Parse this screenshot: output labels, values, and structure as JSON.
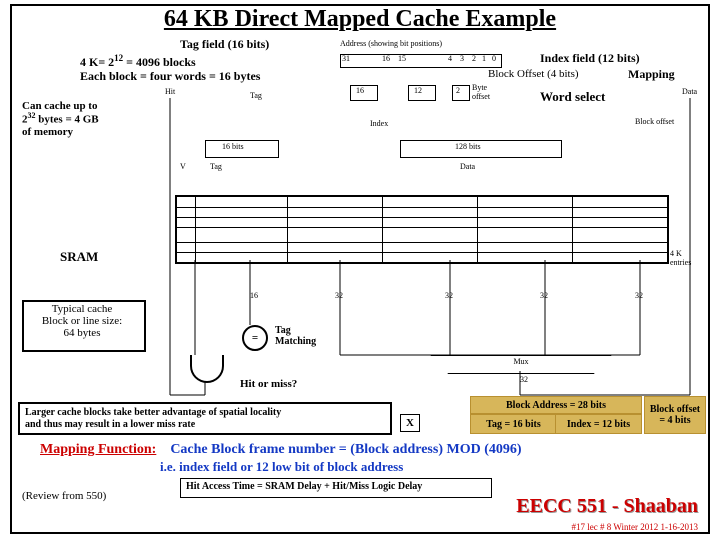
{
  "title": "64 KB Direct Mapped Cache Example",
  "header": {
    "tag_field": "Tag field (16 bits)",
    "addr_caption": "Address (showing bit positions)",
    "blocks_line_a": "4 K= 2",
    "blocks_line_sup": "12",
    "blocks_line_b": "= 4096 blocks",
    "each_block": "Each block = four words = 16 bytes",
    "index_field": "Index field (12 bits)",
    "block_offset": "Block Offset (4 bits)",
    "mapping": "Mapping",
    "word_select": "Word select",
    "hit": "Hit",
    "tag": "Tag",
    "index": "Index",
    "data_r": "Data",
    "block_offset_lbl": "Block offset",
    "bits16": "16 bits",
    "bits128": "128 bits",
    "vlabel": "V",
    "tag2": "Tag",
    "data2": "Data",
    "can_cache_a": "Can cache up to",
    "can_cache_b": "2",
    "can_cache_sup": "32",
    "can_cache_c": " bytes = 4 GB",
    "can_cache_d": "of memory",
    "byte_offset": "Byte\noffset"
  },
  "bit_positions": {
    "a": "31",
    "b": "16",
    "c": "15",
    "d": "4",
    "e": "3",
    "f": "2",
    "g": "1",
    "h": "0",
    "p16": "16",
    "p12": "12",
    "p2": "2"
  },
  "sram": {
    "label": "SRAM",
    "entries": "4 K\nentries",
    "typical": "Typical cache\nBlock or line size:\n64 bytes"
  },
  "lower": {
    "w16": "16",
    "w32": "32",
    "eq": "=",
    "tag_match": "Tag\nMatching",
    "hitmiss": "Hit or miss?",
    "mux": "Mux",
    "w32b": "32"
  },
  "bottom_left": {
    "l1": "Larger cache blocks take better advantage of spatial locality",
    "l2": "and thus may result in a lower miss rate",
    "x": "X"
  },
  "block_addr": {
    "row1": "Block Address  =  28 bits",
    "tag": "Tag = 16 bits",
    "idx": "Index = 12 bits",
    "off": "Block offset\n= 4 bits"
  },
  "mapping_line": {
    "mf": "Mapping Function:",
    "rest": "Cache Block frame number  =  (Block address) MOD (4096)",
    "sub": "i.e. index field or 12 low bit of block address"
  },
  "hit_access": "Hit Access Time = SRAM Delay + Hit/Miss Logic Delay",
  "review": "(Review from 550)",
  "logo": "EECC 551 - Shaaban",
  "footer": "#17 lec # 8   Winter 2012  1-16-2013"
}
